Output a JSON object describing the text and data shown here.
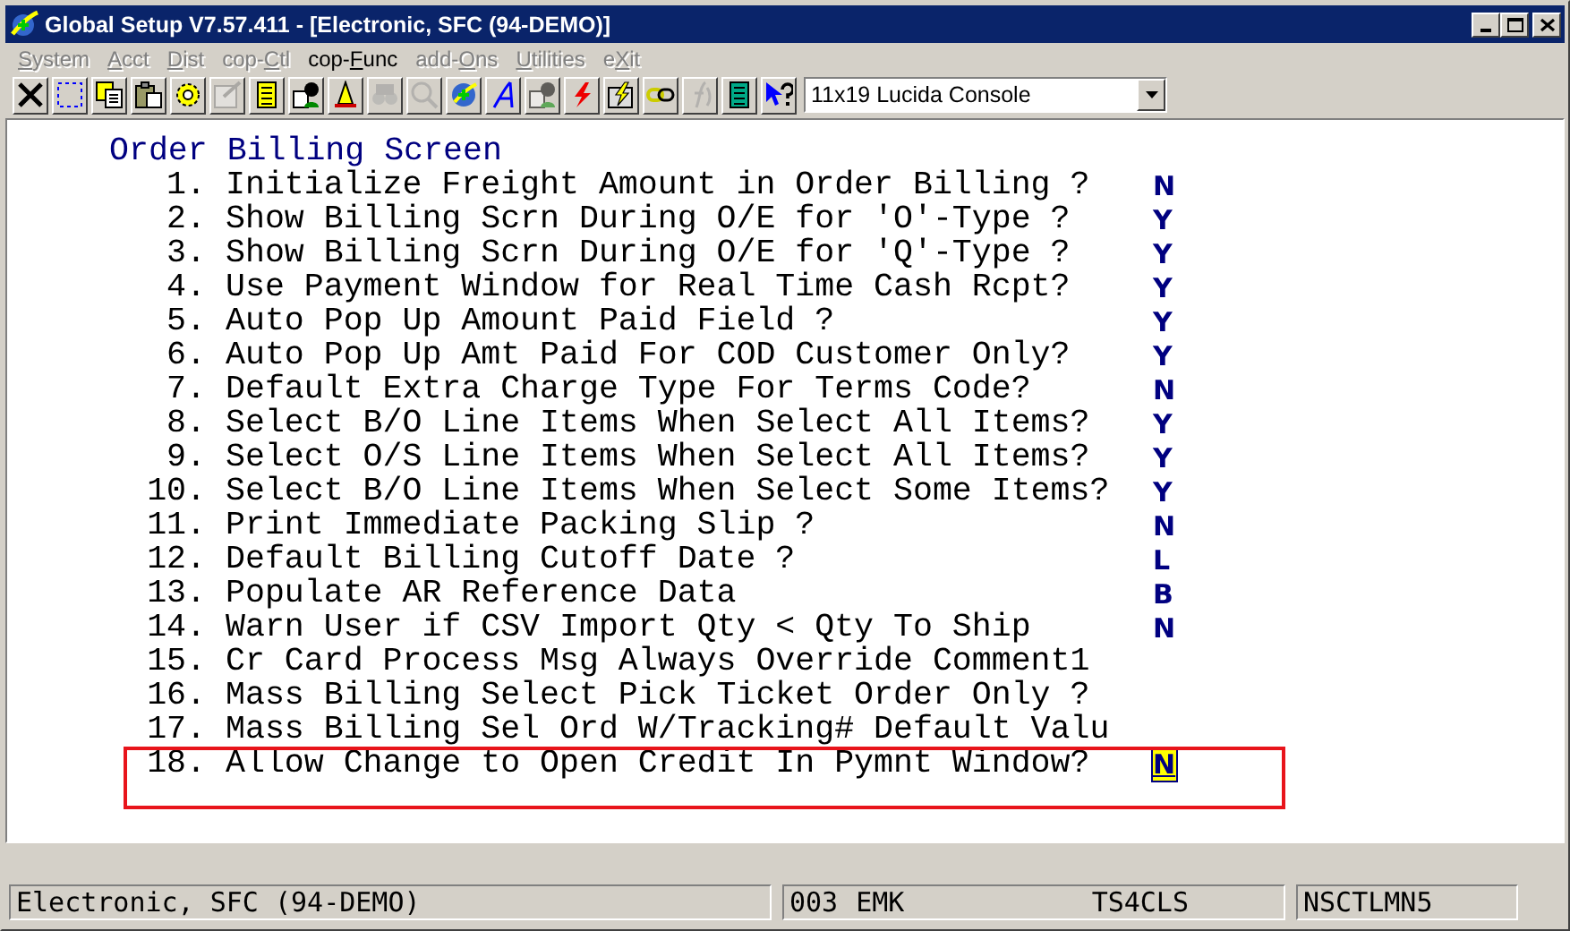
{
  "window": {
    "title": "Global Setup V7.57.411 - [Electronic, SFC (94-DEMO)]"
  },
  "menu": [
    {
      "key": "S",
      "post": "ystem",
      "disabled": true
    },
    {
      "key": "A",
      "post": "cct",
      "disabled": true
    },
    {
      "key": "D",
      "post": "ist",
      "disabled": true
    },
    {
      "pre": "cop-",
      "key": "C",
      "post": "tl",
      "disabled": true
    },
    {
      "pre": "cop-",
      "key": "F",
      "post": "unc",
      "disabled": false
    },
    {
      "pre": "add-",
      "key": "O",
      "post": "ns",
      "disabled": true
    },
    {
      "key": "U",
      "post": "tilities",
      "disabled": true
    },
    {
      "pre": "e",
      "key": "X",
      "post": "it",
      "disabled": true
    }
  ],
  "toolbar": [
    {
      "kind": "close",
      "disabled": false
    },
    {
      "kind": "select",
      "disabled": false
    },
    {
      "kind": "copy",
      "disabled": false
    },
    {
      "kind": "paste",
      "disabled": false
    },
    {
      "kind": "gear",
      "disabled": false
    },
    {
      "kind": "form",
      "disabled": true
    },
    {
      "kind": "notepad",
      "disabled": false
    },
    {
      "kind": "person",
      "disabled": false
    },
    {
      "kind": "bell",
      "disabled": false
    },
    {
      "kind": "binoculars",
      "disabled": true
    },
    {
      "kind": "search",
      "disabled": true
    },
    {
      "kind": "globe",
      "disabled": false
    },
    {
      "kind": "script",
      "disabled": false
    },
    {
      "kind": "person",
      "disabled": true
    },
    {
      "kind": "bolt",
      "disabled": false
    },
    {
      "kind": "boltbox",
      "disabled": false
    },
    {
      "kind": "chain",
      "disabled": false
    },
    {
      "kind": "function",
      "disabled": true
    },
    {
      "kind": "calculator",
      "disabled": false
    },
    {
      "kind": "help",
      "disabled": false
    }
  ],
  "font_select": {
    "value": "11x19 Lucida Console"
  },
  "screen": {
    "title": "Order Billing Screen",
    "rows": [
      {
        "number": "1.",
        "label": "Initialize Freight Amount in Order Billing ?",
        "value": "N",
        "selected": false
      },
      {
        "number": "2.",
        "label": "Show Billing Scrn During O/E for 'O'-Type ?",
        "value": "Y",
        "selected": false
      },
      {
        "number": "3.",
        "label": "Show Billing Scrn During O/E for 'Q'-Type ?",
        "value": "Y",
        "selected": false
      },
      {
        "number": "4.",
        "label": "Use Payment Window for Real Time Cash Rcpt?",
        "value": "Y",
        "selected": false
      },
      {
        "number": "5.",
        "label": "Auto Pop Up Amount Paid Field ?",
        "value": "Y",
        "selected": false
      },
      {
        "number": "6.",
        "label": "Auto Pop Up Amt Paid For COD Customer Only?",
        "value": "Y",
        "selected": false
      },
      {
        "number": "7.",
        "label": "Default Extra Charge Type For Terms Code?",
        "value": "N",
        "selected": false
      },
      {
        "number": "8.",
        "label": "Select B/O Line Items When Select All Items?",
        "value": "Y",
        "selected": false
      },
      {
        "number": "9.",
        "label": "Select O/S Line Items When Select All Items?",
        "value": "Y",
        "selected": false
      },
      {
        "number": "10.",
        "label": "Select B/O Line Items When Select Some Items?",
        "value": "Y",
        "selected": false
      },
      {
        "number": "11.",
        "label": "Print Immediate Packing Slip ?",
        "value": "N",
        "selected": false
      },
      {
        "number": "12.",
        "label": "Default Billing Cutoff Date ?",
        "value": "L",
        "selected": false
      },
      {
        "number": "13.",
        "label": "Populate AR Reference Data",
        "value": "B",
        "selected": false
      },
      {
        "number": "14.",
        "label": "Warn User if CSV Import Qty < Qty To Ship",
        "value": "N",
        "selected": false
      },
      {
        "number": "15.",
        "label": "Cr Card Process Msg Always Override Comment1",
        "selected": false
      },
      {
        "number": "16.",
        "label": "Mass Billing Select Pick Ticket Order Only ?",
        "selected": false
      },
      {
        "number": "17.",
        "label": "Mass Billing Sel Ord W/Tracking# Default Valu",
        "selected": false
      },
      {
        "number": "18.",
        "label": "Allow Change to Open Credit In Pymnt Window?",
        "value": "N",
        "selected": true
      }
    ]
  },
  "status_bar": {
    "company": "Electronic, SFC (94-DEMO)",
    "code": "003",
    "user": "EMK",
    "station": "TS4CLS",
    "program": "NSCTLMN5"
  }
}
